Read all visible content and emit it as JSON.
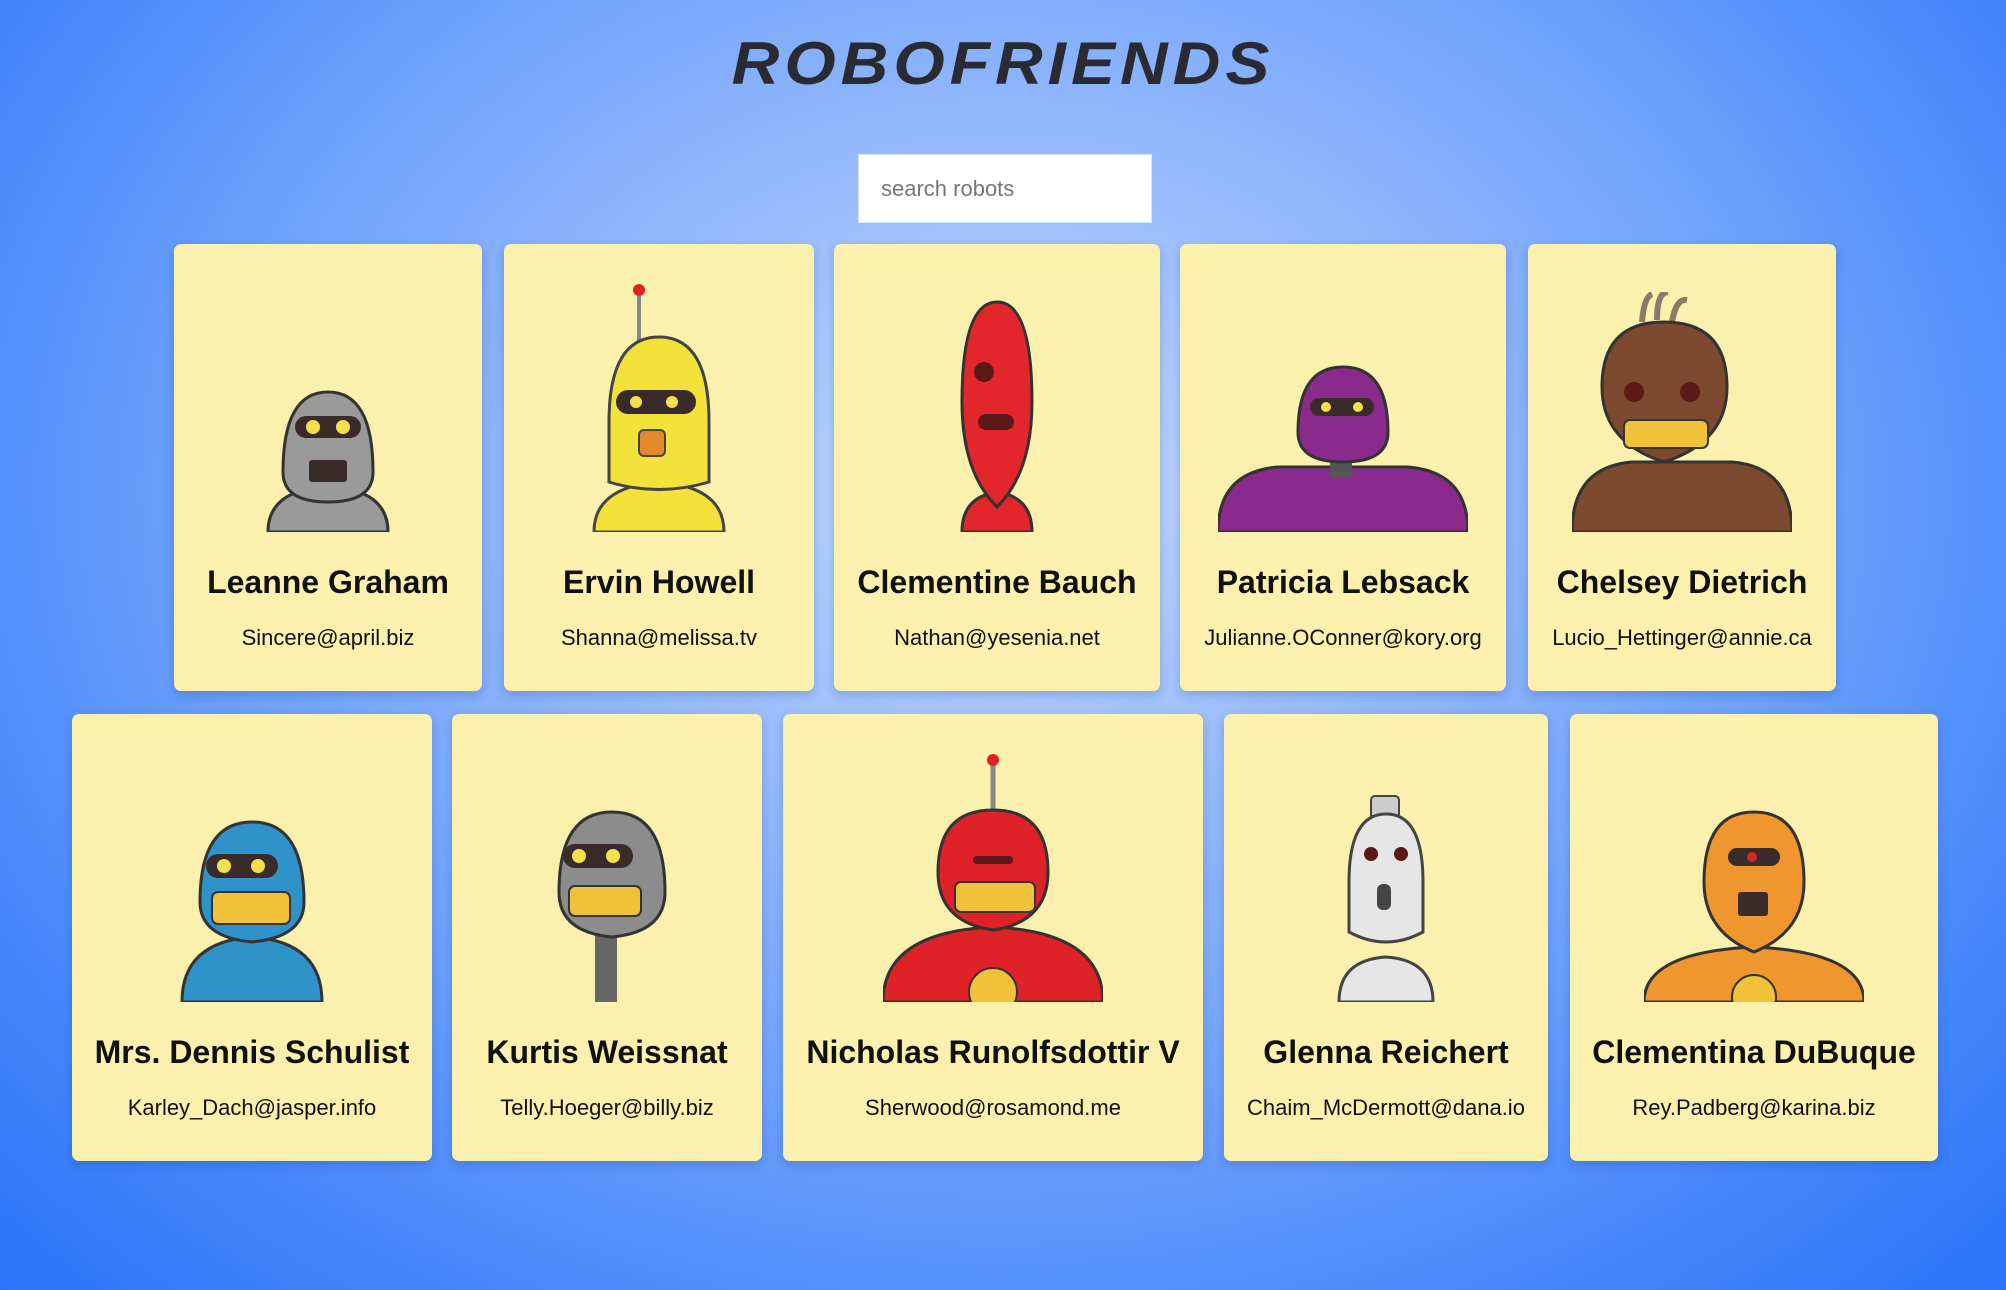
{
  "app": {
    "title": "ROBOFRIENDS"
  },
  "search": {
    "placeholder": "search robots",
    "value": ""
  },
  "robots": [
    {
      "name": "Leanne Graham",
      "email": "Sincere@april.biz",
      "color": "#9a9a9a"
    },
    {
      "name": "Ervin Howell",
      "email": "Shanna@melissa.tv",
      "color": "#f2e23a"
    },
    {
      "name": "Clementine Bauch",
      "email": "Nathan@yesenia.net",
      "color": "#e3262b"
    },
    {
      "name": "Patricia Lebsack",
      "email": "Julianne.OConner@kory.org",
      "color": "#8a2a8c"
    },
    {
      "name": "Chelsey Dietrich",
      "email": "Lucio_Hettinger@annie.ca",
      "color": "#7d4a2f"
    },
    {
      "name": "Mrs. Dennis Schulist",
      "email": "Karley_Dach@jasper.info",
      "color": "#2f93c9"
    },
    {
      "name": "Kurtis Weissnat",
      "email": "Telly.Hoeger@billy.biz",
      "color": "#8c8c8c"
    },
    {
      "name": "Nicholas Runolfsdottir V",
      "email": "Sherwood@rosamond.me",
      "color": "#de2228"
    },
    {
      "name": "Glenna Reichert",
      "email": "Chaim_McDermott@dana.io",
      "color": "#e6e6e6"
    },
    {
      "name": "Clementina DuBuque",
      "email": "Rey.Padberg@karina.biz",
      "color": "#f0962e"
    }
  ]
}
